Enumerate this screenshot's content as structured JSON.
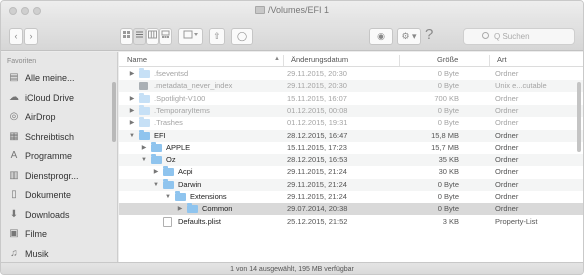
{
  "window": {
    "title": "/Volumes/EFI 1"
  },
  "toolbar": {
    "back": "‹",
    "forward": "›",
    "share": "⇧",
    "tag": "◯",
    "eye": "◉",
    "gear": "⚙ ▾",
    "help": "?",
    "search_placeholder": "Q Suchen"
  },
  "sidebar": {
    "header": "Favoriten",
    "items": [
      {
        "label": "Alle meine...",
        "icon": "all-files-icon"
      },
      {
        "label": "iCloud Drive",
        "icon": "cloud-icon"
      },
      {
        "label": "AirDrop",
        "icon": "airdrop-icon"
      },
      {
        "label": "Schreibtisch",
        "icon": "desktop-icon"
      },
      {
        "label": "Programme",
        "icon": "applications-icon"
      },
      {
        "label": "Dienstprogr...",
        "icon": "utilities-icon"
      },
      {
        "label": "Dokumente",
        "icon": "documents-icon"
      },
      {
        "label": "Downloads",
        "icon": "downloads-icon"
      },
      {
        "label": "Filme",
        "icon": "movies-icon"
      },
      {
        "label": "Musik",
        "icon": "music-icon"
      }
    ]
  },
  "columns": {
    "name": "Name",
    "date": "Änderungsdatum",
    "size": "Größe",
    "kind": "Art"
  },
  "rows": [
    {
      "name": ".fseventsd",
      "date": "29.11.2015, 20:30",
      "size": "0 Byte",
      "kind": "Ordner",
      "type": "folder",
      "depth": 0,
      "disclosure": "▶",
      "dim": true
    },
    {
      "name": ".metadata_never_index",
      "date": "29.11.2015, 20:30",
      "size": "0 Byte",
      "kind": "Unix e...cutable",
      "type": "file",
      "depth": 0,
      "disclosure": "",
      "dim": true
    },
    {
      "name": ".Spotlight-V100",
      "date": "15.11.2015, 16:07",
      "size": "700 KB",
      "kind": "Ordner",
      "type": "folder",
      "depth": 0,
      "disclosure": "▶",
      "dim": true
    },
    {
      "name": ".TemporaryItems",
      "date": "01.12.2015, 00:08",
      "size": "0 Byte",
      "kind": "Ordner",
      "type": "folder",
      "depth": 0,
      "disclosure": "▶",
      "dim": true
    },
    {
      "name": ".Trashes",
      "date": "01.12.2015, 19:31",
      "size": "0 Byte",
      "kind": "Ordner",
      "type": "folder",
      "depth": 0,
      "disclosure": "▶",
      "dim": true
    },
    {
      "name": "EFI",
      "date": "28.12.2015, 16:47",
      "size": "15,8 MB",
      "kind": "Ordner",
      "type": "folder",
      "depth": 0,
      "disclosure": "▼",
      "dim": false
    },
    {
      "name": "APPLE",
      "date": "15.11.2015, 17:23",
      "size": "15,7 MB",
      "kind": "Ordner",
      "type": "folder",
      "depth": 1,
      "disclosure": "▶",
      "dim": false
    },
    {
      "name": "Oz",
      "date": "28.12.2015, 16:53",
      "size": "35 KB",
      "kind": "Ordner",
      "type": "folder",
      "depth": 1,
      "disclosure": "▼",
      "dim": false
    },
    {
      "name": "Acpi",
      "date": "29.11.2015, 21:24",
      "size": "30 KB",
      "kind": "Ordner",
      "type": "folder",
      "depth": 2,
      "disclosure": "▶",
      "dim": false
    },
    {
      "name": "Darwin",
      "date": "29.11.2015, 21:24",
      "size": "0 Byte",
      "kind": "Ordner",
      "type": "folder",
      "depth": 2,
      "disclosure": "▼",
      "dim": false
    },
    {
      "name": "Extensions",
      "date": "29.11.2015, 21:24",
      "size": "0 Byte",
      "kind": "Ordner",
      "type": "folder",
      "depth": 3,
      "disclosure": "▼",
      "dim": false
    },
    {
      "name": "Common",
      "date": "29.07.2014, 20:38",
      "size": "0 Byte",
      "kind": "Ordner",
      "type": "folder",
      "depth": 4,
      "disclosure": "▶",
      "dim": false,
      "selected": true
    },
    {
      "name": "Defaults.plist",
      "date": "25.12.2015, 21:52",
      "size": "3 KB",
      "kind": "Property-List",
      "type": "doc",
      "depth": 2,
      "disclosure": "",
      "dim": false
    }
  ],
  "status": {
    "text": "1 von 14 ausgewählt, 195 MB verfügbar"
  }
}
